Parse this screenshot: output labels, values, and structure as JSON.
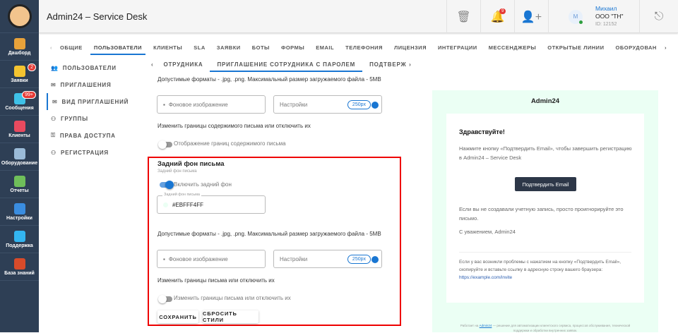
{
  "app": {
    "title": "Admin24 – Service Desk"
  },
  "sidebar": [
    {
      "label": "Дашборд",
      "icon": "dashboard-icon",
      "color": "#e8a23a"
    },
    {
      "label": "Заявки",
      "icon": "megaphone-icon",
      "color": "#f4c430",
      "badge": "2"
    },
    {
      "label": "Сообщения",
      "icon": "chat-icon",
      "color": "#3ec1e8",
      "badge": "99+"
    },
    {
      "label": "Клиенты",
      "icon": "clients-icon",
      "color": "#e84a5f"
    },
    {
      "label": "Оборудование",
      "icon": "equipment-icon",
      "color": "#9bbbd8"
    },
    {
      "label": "Отчеты",
      "icon": "reports-icon",
      "color": "#6fbf5a"
    },
    {
      "label": "Настройки",
      "icon": "gear-icon",
      "color": "#3a8de0"
    },
    {
      "label": "Поддержка",
      "icon": "help-icon",
      "color": "#33b5f0"
    },
    {
      "label": "База знаний",
      "icon": "book-icon",
      "color": "#d84b2a"
    }
  ],
  "header": {
    "notifications": "9",
    "user_name": "Михаил",
    "org": "ООО \"ТН\"",
    "user_id": "ID: 12152",
    "avatar_letter": "М"
  },
  "tabs": [
    "ОБЩИЕ",
    "ПОЛЬЗОВАТЕЛИ",
    "КЛИЕНТЫ",
    "SLA",
    "ЗАЯВКИ",
    "БОТЫ",
    "ФОРМЫ",
    "EMAIL",
    "ТЕЛЕФОНИЯ",
    "ЛИЦЕНЗИЯ",
    "ИНТЕГРАЦИИ",
    "МЕССЕНДЖЕРЫ",
    "ОТКРЫТЫЕ ЛИНИИ",
    "ОБОРУДОВАН"
  ],
  "left_nav": [
    "ПОЛЬЗОВАТЕЛИ",
    "ПРИГЛАШЕНИЯ",
    "ВИД ПРИГЛАШЕНИЙ",
    "ГРУППЫ",
    "ПРАВА ДОСТУПА",
    "РЕГИСТРАЦИЯ"
  ],
  "sub_tabs": [
    "ОТРУДНИКА",
    "ПРИГЛАШЕНИЕ СОТРУДНИКА С ПАРОЛЕМ",
    "ПОДТВЕРЖДЕ"
  ],
  "form": {
    "formats": "Допустимые форматы - .jpg, .png. Максимальный размер загружаемого файла - 5MB",
    "bg_image": "Фоновое изображение",
    "settings": "Настройки",
    "size": "250px",
    "content_border_title": "Изменить границы содержимого письма или отключить их",
    "content_border_toggle": "Отображение границ содержимого письма",
    "section_title": "Задний фон письма",
    "section_sub": "Задний фон письма",
    "enable_bg": "Включить задний фон",
    "bg_color_label": "Задний фон письма",
    "bg_color_value": "#EBFFF4FF",
    "border_title": "Изменить границы письма или отключить их",
    "border_toggle": "Изменить границы письма или отключить их",
    "save": "СОХРАНИТЬ",
    "reset": "СБРОСИТЬ СТИЛИ"
  },
  "preview": {
    "brand": "Admin24",
    "greeting": "Здравствуйте!",
    "intro": "Нажмите кнопку «Подтвердить Email», чтобы завершить регистрацию в Admin24 – Service Desk",
    "button": "Подтвердить Email",
    "ignore": "Если вы не создавали учетную запись, просто проигнорируйте это письмо.",
    "regards": "С уважением, Admin24",
    "trouble": "Если у вас возникли проблемы с нажатием на кнопку «Подтвердить Email», скопируйте и вставьте ссылку в адресную строку вашего браузера:",
    "link": "https://example.com/invite",
    "footer_prefix": "Работает на",
    "footer_link": "Admin24",
    "footer_text": "— решение для автоматизации клиентского сервиса, процессов обслуживания, технической поддержки и обработки внутренних заявок."
  }
}
